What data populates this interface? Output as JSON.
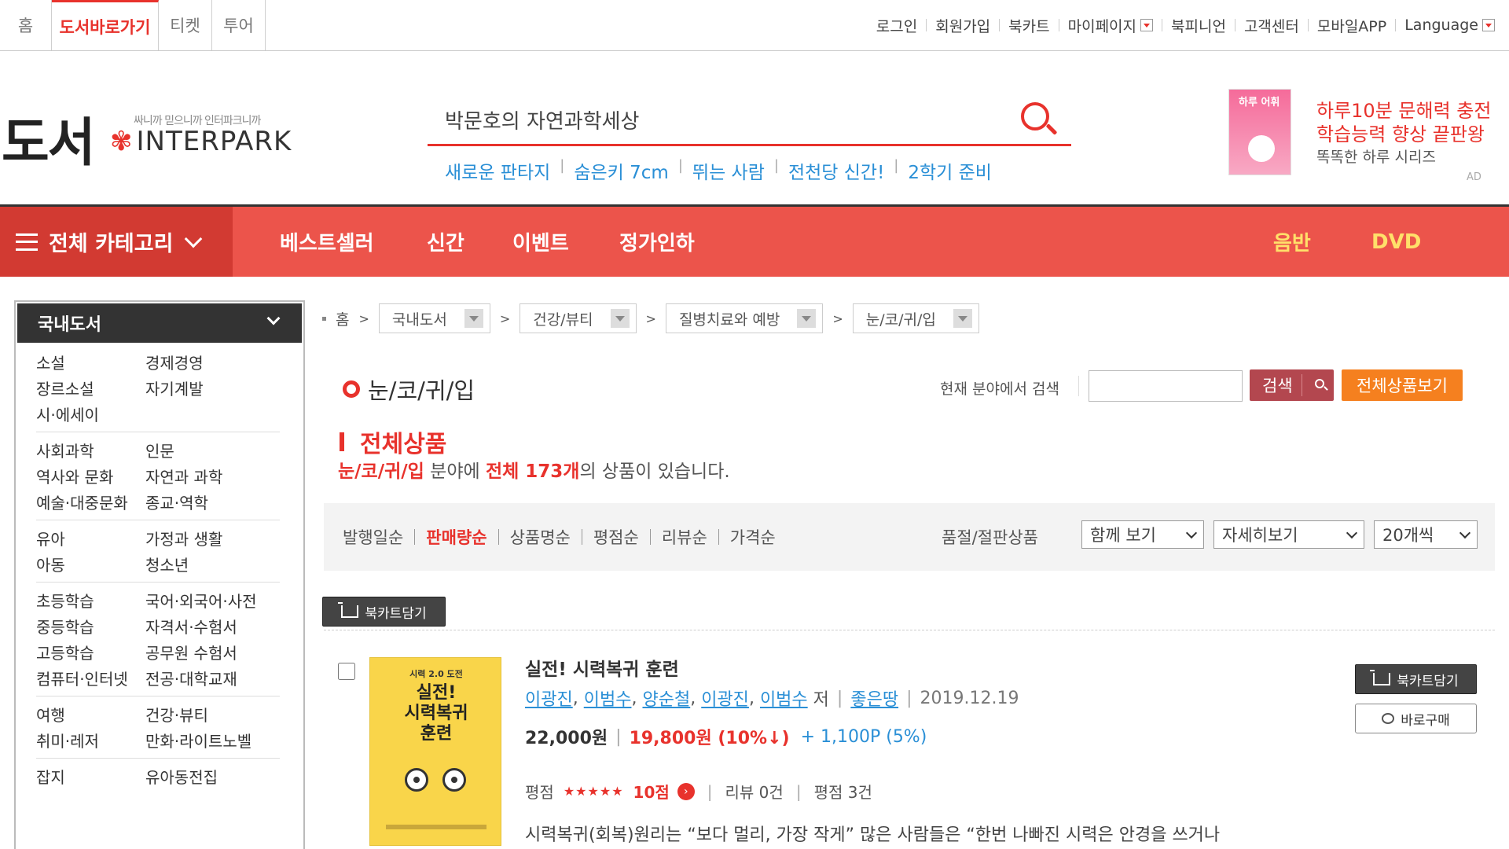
{
  "top_tabs": [
    {
      "label": "홈",
      "active": false
    },
    {
      "label": "도서바로가기",
      "active": true
    },
    {
      "label": "티켓",
      "active": false
    },
    {
      "label": "투어",
      "active": false
    }
  ],
  "top_links": [
    "로그인",
    "회원가입",
    "북카트",
    "마이페이지",
    "북피니언",
    "고객센터",
    "모바일APP",
    "Language"
  ],
  "logo": {
    "main": "도서",
    "slogan": "싸니까 믿으니까 인터파크니까",
    "brand": "INTERPARK"
  },
  "search": {
    "query": "박문호의 자연과학세상"
  },
  "hot_keywords": [
    "새로운 판타지",
    "숨은키 7cm",
    "뛰는 사람",
    "전천당 신간!",
    "2학기 준비"
  ],
  "ad": {
    "book_title": "하루 어휘",
    "line1": "하루10분 문해력 충전",
    "line2": "학습능력 향상 끝판왕",
    "line3": "똑똑한 하루 시리즈",
    "label": "AD"
  },
  "nav": {
    "all_categories": "전체 카테고리",
    "items": [
      "베스트셀러",
      "신간",
      "이벤트",
      "정가인하"
    ],
    "right_items": [
      "음반",
      "DVD"
    ]
  },
  "sidebar": {
    "title": "국내도서",
    "groups": [
      [
        [
          "소설",
          "경제경영"
        ],
        [
          "장르소설",
          "자기계발"
        ],
        [
          "시·에세이",
          ""
        ]
      ],
      [
        [
          "사회과학",
          "인문"
        ],
        [
          "역사와 문화",
          "자연과 과학"
        ],
        [
          "예술·대중문화",
          "종교·역학"
        ]
      ],
      [
        [
          "유아",
          "가정과 생활"
        ],
        [
          "아동",
          "청소년"
        ]
      ],
      [
        [
          "초등학습",
          "국어·외국어·사전"
        ],
        [
          "중등학습",
          "자격서·수험서"
        ],
        [
          "고등학습",
          "공무원 수험서"
        ],
        [
          "컴퓨터·인터넷",
          "전공·대학교재"
        ]
      ],
      [
        [
          "여행",
          "건강·뷰티"
        ],
        [
          "취미·레저",
          "만화·라이트노벨"
        ]
      ],
      [
        [
          "잡지",
          "유아동전집"
        ]
      ]
    ]
  },
  "breadcrumb": {
    "home": "홈",
    "levels": [
      "국내도서",
      "건강/뷰티",
      "질병치료와 예방",
      "눈/코/귀/입"
    ]
  },
  "category": {
    "title": "눈/코/귀/입",
    "field_search_label": "현재 분야에서 검색",
    "search_button": "검색",
    "all_products_button": "전체상품보기",
    "section_title": "전체상품",
    "count_prefix": "눈/코/귀/입",
    "count_mid": " 분야에 ",
    "count_total_label": "전체 173개",
    "count_suffix": "의 상품이 있습니다."
  },
  "sort": {
    "options": [
      "발행일순",
      "판매량순",
      "상품명순",
      "평점순",
      "리뷰순",
      "가격순"
    ],
    "active_index": 1,
    "soldout_label": "품절/절판상품",
    "selects": [
      "함께 보기",
      "자세히보기",
      "20개씩"
    ]
  },
  "cart_button": "북카트담기",
  "product": {
    "cover_small": "시력 2.0 도전",
    "cover_title_1": "실전!",
    "cover_title_2": "시력복귀",
    "cover_title_3": "훈련",
    "title": "실전! 시력복귀 훈련",
    "authors": [
      "이광진",
      "이범수",
      "양순철",
      "이광진",
      "이범수"
    ],
    "author_suffix": "저",
    "publisher": "좋은땅",
    "date": "2019.12.19",
    "list_price": "22,000원",
    "sale_price": "19,800원 (10%↓)",
    "points": "+ 1,100P (5%)",
    "rating_label": "평점",
    "stars": "★★★★★",
    "score": "10점",
    "reviews": "리뷰 0건",
    "ratings": "평점 3건",
    "description": "시력복귀(회복)원리는 “보다 멀리, 가장 작게” 많은 사람들은 “한번 나빠진 시력은 안경을 쓰거나",
    "cart_button": "북카트담기",
    "buy_button": "바로구매"
  },
  "colors": {
    "accent": "#e8322c",
    "nav_bg": "#ec544b",
    "link": "#2a8fd6",
    "orange": "#f5801f"
  }
}
